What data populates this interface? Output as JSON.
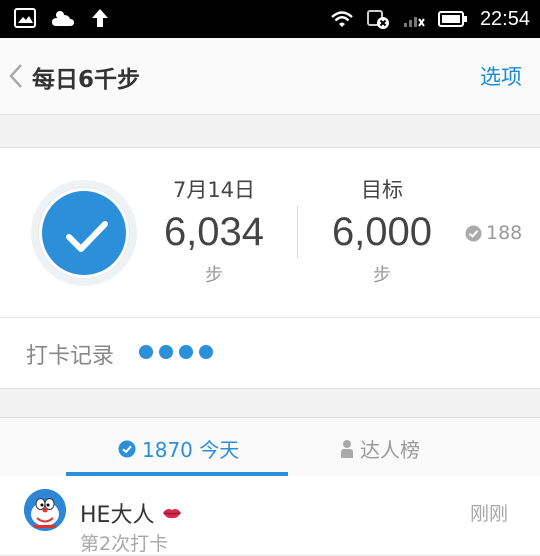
{
  "status_bar": {
    "time": "22:54",
    "icons": [
      "image-icon",
      "weather-cloud-icon",
      "upload-arrow-icon",
      "wifi-icon",
      "data-off-icon",
      "signal-icon",
      "battery-icon"
    ]
  },
  "header": {
    "title": "每日6千步",
    "options_label": "选项"
  },
  "summary": {
    "today": {
      "label": "7月14日",
      "value": "6,034",
      "unit": "步"
    },
    "target": {
      "label": "目标",
      "value": "6,000",
      "unit": "步"
    },
    "badge_count": "188"
  },
  "checkin": {
    "label": "打卡记录",
    "dots": 4
  },
  "tabs": [
    {
      "label": "1870 今天",
      "active": true
    },
    {
      "label": "达人榜",
      "active": false
    }
  ],
  "feed": [
    {
      "name": "HE大人",
      "time": "刚刚",
      "subtitle": "第2次打卡"
    }
  ],
  "colors": {
    "accent": "#2b8fda",
    "link": "#1a8ad4"
  }
}
